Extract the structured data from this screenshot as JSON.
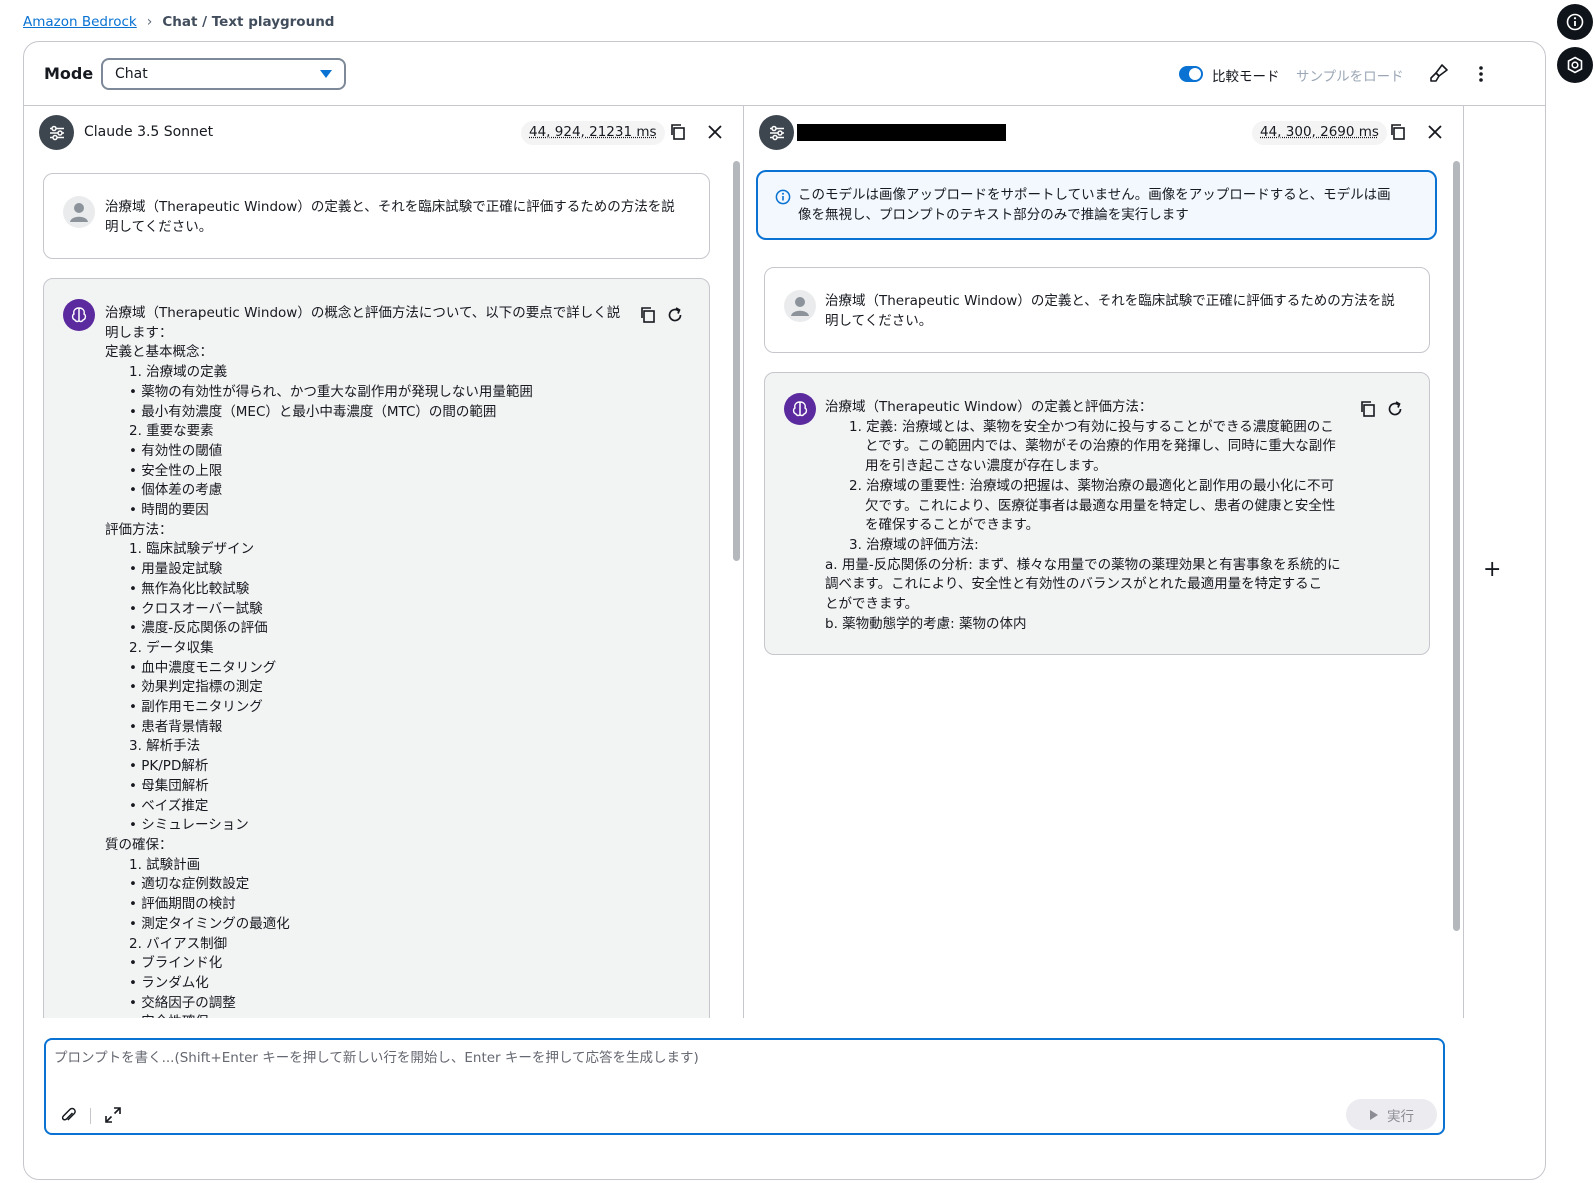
{
  "breadcrumb": {
    "root": "Amazon Bedrock",
    "current": "Chat / Text playground"
  },
  "header": {
    "mode_label": "Mode",
    "mode_value": "Chat",
    "compare_mode_label": "比較モード",
    "compare_mode_on": true,
    "load_sample_label": "サンプルをロード"
  },
  "left_panel": {
    "model_name": "Claude 3.5 Sonnet",
    "metrics": "44, 924, 21231 ms",
    "user_message": [
      "治療域（Therapeutic Window）の定義と、それを臨床試験で正確に評価するための方法を説",
      "明してください。"
    ],
    "response_lines": [
      {
        "t": "治療域（Therapeutic Window）の概念と評価方法について、以下の要点で詳しく説",
        "k": "p"
      },
      {
        "t": "明します：",
        "k": "p"
      },
      {
        "t": "定義と基本概念：",
        "k": "p"
      },
      {
        "t": "1. 治療域の定義",
        "k": "n"
      },
      {
        "t": "薬物の有効性が得られ、かつ重大な副作用が発現しない用量範囲",
        "k": "b"
      },
      {
        "t": "最小有効濃度（MEC）と最小中毒濃度（MTC）の間の範囲",
        "k": "b"
      },
      {
        "t": "2. 重要な要素",
        "k": "n"
      },
      {
        "t": "有効性の閾値",
        "k": "b"
      },
      {
        "t": "安全性の上限",
        "k": "b"
      },
      {
        "t": "個体差の考慮",
        "k": "b"
      },
      {
        "t": "時間的要因",
        "k": "b"
      },
      {
        "t": "評価方法：",
        "k": "p"
      },
      {
        "t": "1. 臨床試験デザイン",
        "k": "n"
      },
      {
        "t": "用量設定試験",
        "k": "b"
      },
      {
        "t": "無作為化比較試験",
        "k": "b"
      },
      {
        "t": "クロスオーバー試験",
        "k": "b"
      },
      {
        "t": "濃度-反応関係の評価",
        "k": "b"
      },
      {
        "t": "2. データ収集",
        "k": "n"
      },
      {
        "t": "血中濃度モニタリング",
        "k": "b"
      },
      {
        "t": "効果判定指標の測定",
        "k": "b"
      },
      {
        "t": "副作用モニタリング",
        "k": "b"
      },
      {
        "t": "患者背景情報",
        "k": "b"
      },
      {
        "t": "3. 解析手法",
        "k": "n"
      },
      {
        "t": "PK/PD解析",
        "k": "b"
      },
      {
        "t": "母集団解析",
        "k": "b"
      },
      {
        "t": "ベイズ推定",
        "k": "b"
      },
      {
        "t": "シミュレーション",
        "k": "b"
      },
      {
        "t": "質の確保：",
        "k": "p"
      },
      {
        "t": "1. 試験計画",
        "k": "n"
      },
      {
        "t": "適切な症例数設定",
        "k": "b"
      },
      {
        "t": "評価期間の検討",
        "k": "b"
      },
      {
        "t": "測定タイミングの最適化",
        "k": "b"
      },
      {
        "t": "2. バイアス制御",
        "k": "n"
      },
      {
        "t": "ブラインド化",
        "k": "b"
      },
      {
        "t": "ランダム化",
        "k": "b"
      },
      {
        "t": "交絡因子の調整",
        "k": "b"
      },
      {
        "t": "安全性確保",
        "k": "b"
      }
    ]
  },
  "right_panel": {
    "metrics": "44, 300, 2690 ms",
    "info_message": [
      "このモデルは画像アップロードをサポートしていません。画像をアップロードすると、モデルは画",
      "像を無視し、プロンプトのテキスト部分のみで推論を実行します"
    ],
    "user_message": [
      "治療域（Therapeutic Window）の定義と、それを臨床試験で正確に評価するための方法を説",
      "明してください。"
    ],
    "response_lines": [
      {
        "t": "治療域（Therapeutic Window）の定義と評価方法：",
        "k": "p"
      },
      {
        "t": "1. 定義: 治療域とは、薬物を安全かつ有効に投与することができる濃度範囲のこ",
        "k": "n"
      },
      {
        "t": "とです。この範囲内では、薬物がその治療的作用を発揮し、同時に重大な副作",
        "k": "c"
      },
      {
        "t": "用を引き起こさない濃度が存在します。",
        "k": "c"
      },
      {
        "t": "2. 治療域の重要性: 治療域の把握は、薬物治療の最適化と副作用の最小化に不可",
        "k": "n"
      },
      {
        "t": "欠です。これにより、医療従事者は最適な用量を特定し、患者の健康と安全性",
        "k": "c"
      },
      {
        "t": "を確保することができます。",
        "k": "c"
      },
      {
        "t": "3. 治療域の評価方法:",
        "k": "n"
      },
      {
        "t": "a. 用量-反応関係の分析: まず、様々な用量での薬物の薬理効果と有害事象を系統的に",
        "k": "p"
      },
      {
        "t": "調べます。これにより、安全性と有効性のバランスがとれた最適用量を特定するこ",
        "k": "p"
      },
      {
        "t": "とができます。",
        "k": "p"
      },
      {
        "t": "b. 薬物動態学的考慮: 薬物の体内",
        "k": "p"
      }
    ]
  },
  "prompt": {
    "placeholder": "プロンプトを書く...(Shift+Enter キーを押して新しい行を開始し、Enter キーを押して応答を生成します)",
    "run_label": "実行"
  },
  "icons": {
    "settings": "settings-sliders-icon",
    "copy": "copy-icon",
    "close": "close-icon",
    "refresh": "refresh-icon",
    "info": "info-icon",
    "attach": "paperclip-icon",
    "expand": "expand-icon",
    "brush": "clear-brush-icon",
    "kebab": "more-vertical-icon",
    "play": "play-icon"
  },
  "colors": {
    "accent": "#0972d3",
    "ai_avatar": "#5b2a9e",
    "dark": "#0f141a"
  }
}
